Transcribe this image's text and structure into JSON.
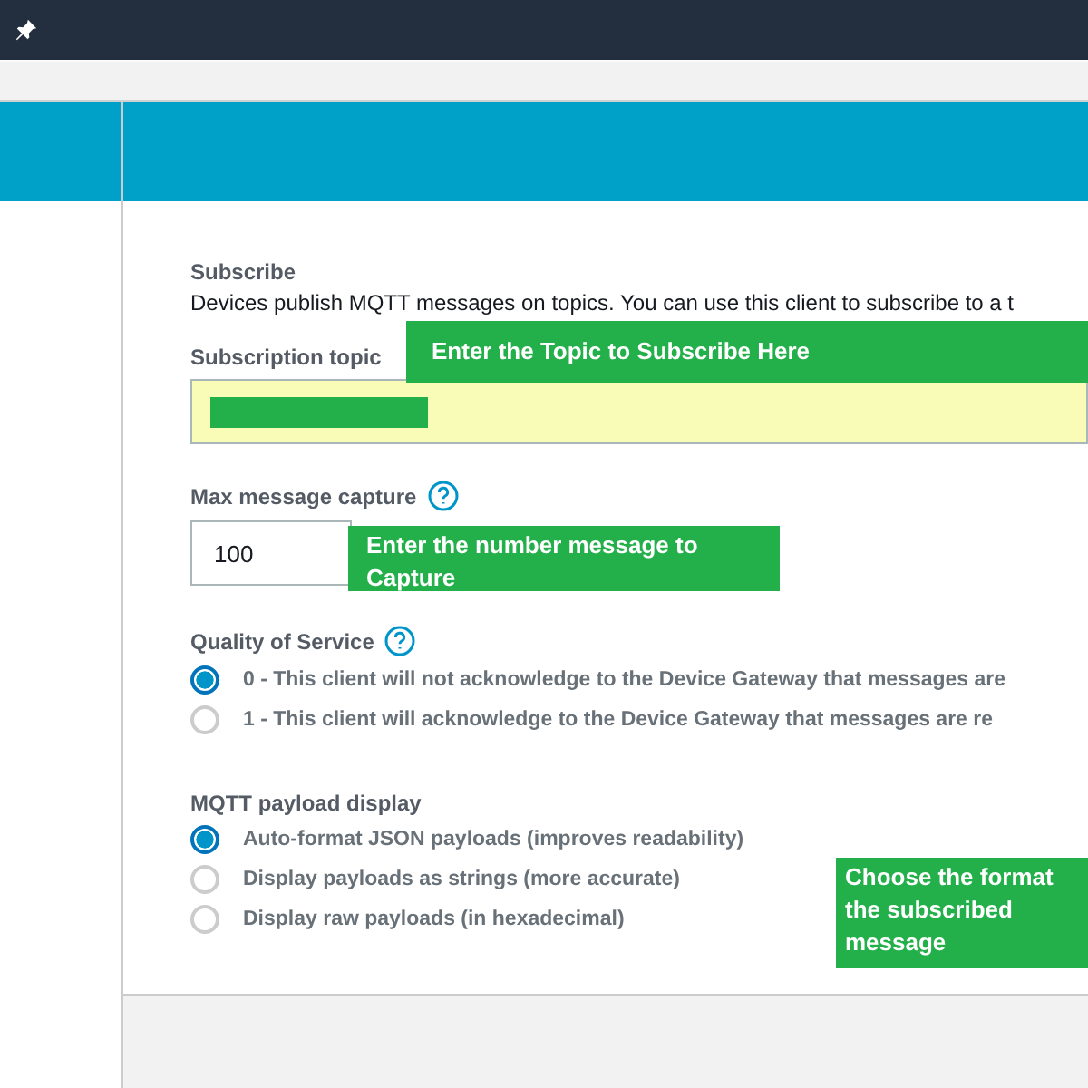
{
  "subscribe": {
    "title": "Subscribe",
    "description": "Devices publish MQTT messages on topics. You can use this client to subscribe to a t",
    "topic_label": "Subscription topic",
    "max_label": "Max message capture",
    "max_value": "100",
    "qos_label": "Quality of Service",
    "qos_options": [
      {
        "label": "0 - This client will not acknowledge to the Device Gateway that messages are",
        "selected": true
      },
      {
        "label": "1 - This client will acknowledge to the Device Gateway that messages are re",
        "selected": false
      }
    ],
    "payload_label": "MQTT payload display",
    "payload_options": [
      {
        "label": "Auto-format JSON payloads (improves readability)",
        "selected": true
      },
      {
        "label": "Display payloads as strings (more accurate)",
        "selected": false
      },
      {
        "label": "Display raw payloads (in hexadecimal)",
        "selected": false
      }
    ]
  },
  "annotations": [
    {
      "lines": [
        "Enter the Topic to Subscribe Here"
      ]
    },
    {
      "lines": [
        "Enter the number message to",
        "Capture"
      ]
    },
    {
      "lines": [
        "Choose the format",
        "the subscribed",
        "message"
      ]
    }
  ]
}
